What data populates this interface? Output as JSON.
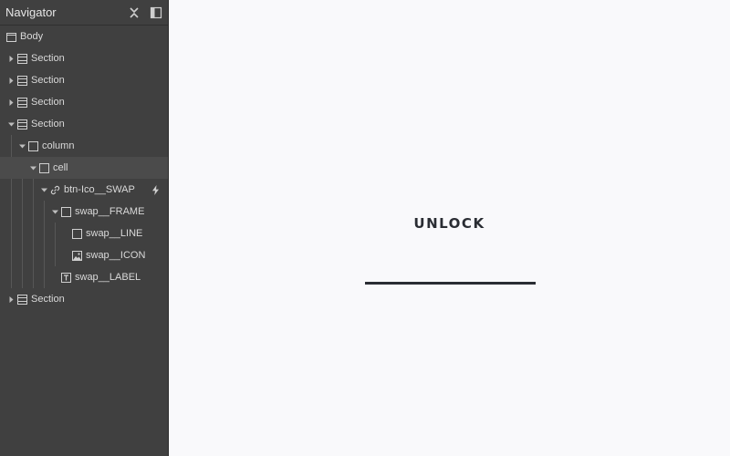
{
  "navigator": {
    "title": "Navigator",
    "items": [
      {
        "label": "Body"
      },
      {
        "label": "Section"
      },
      {
        "label": "Section"
      },
      {
        "label": "Section"
      },
      {
        "label": "Section"
      },
      {
        "label": "column"
      },
      {
        "label": "cell"
      },
      {
        "label": "btn-Ico__SWAP"
      },
      {
        "label": "swap__FRAME"
      },
      {
        "label": "swap__LINE"
      },
      {
        "label": "swap__ICON"
      },
      {
        "label": "swap__LABEL"
      },
      {
        "label": "Section"
      }
    ]
  },
  "canvas": {
    "button_label": "UNLOCK"
  },
  "colors": {
    "panel_bg": "#404040",
    "canvas_bg": "#f9f9fb",
    "text_dark": "#2a2d33"
  }
}
